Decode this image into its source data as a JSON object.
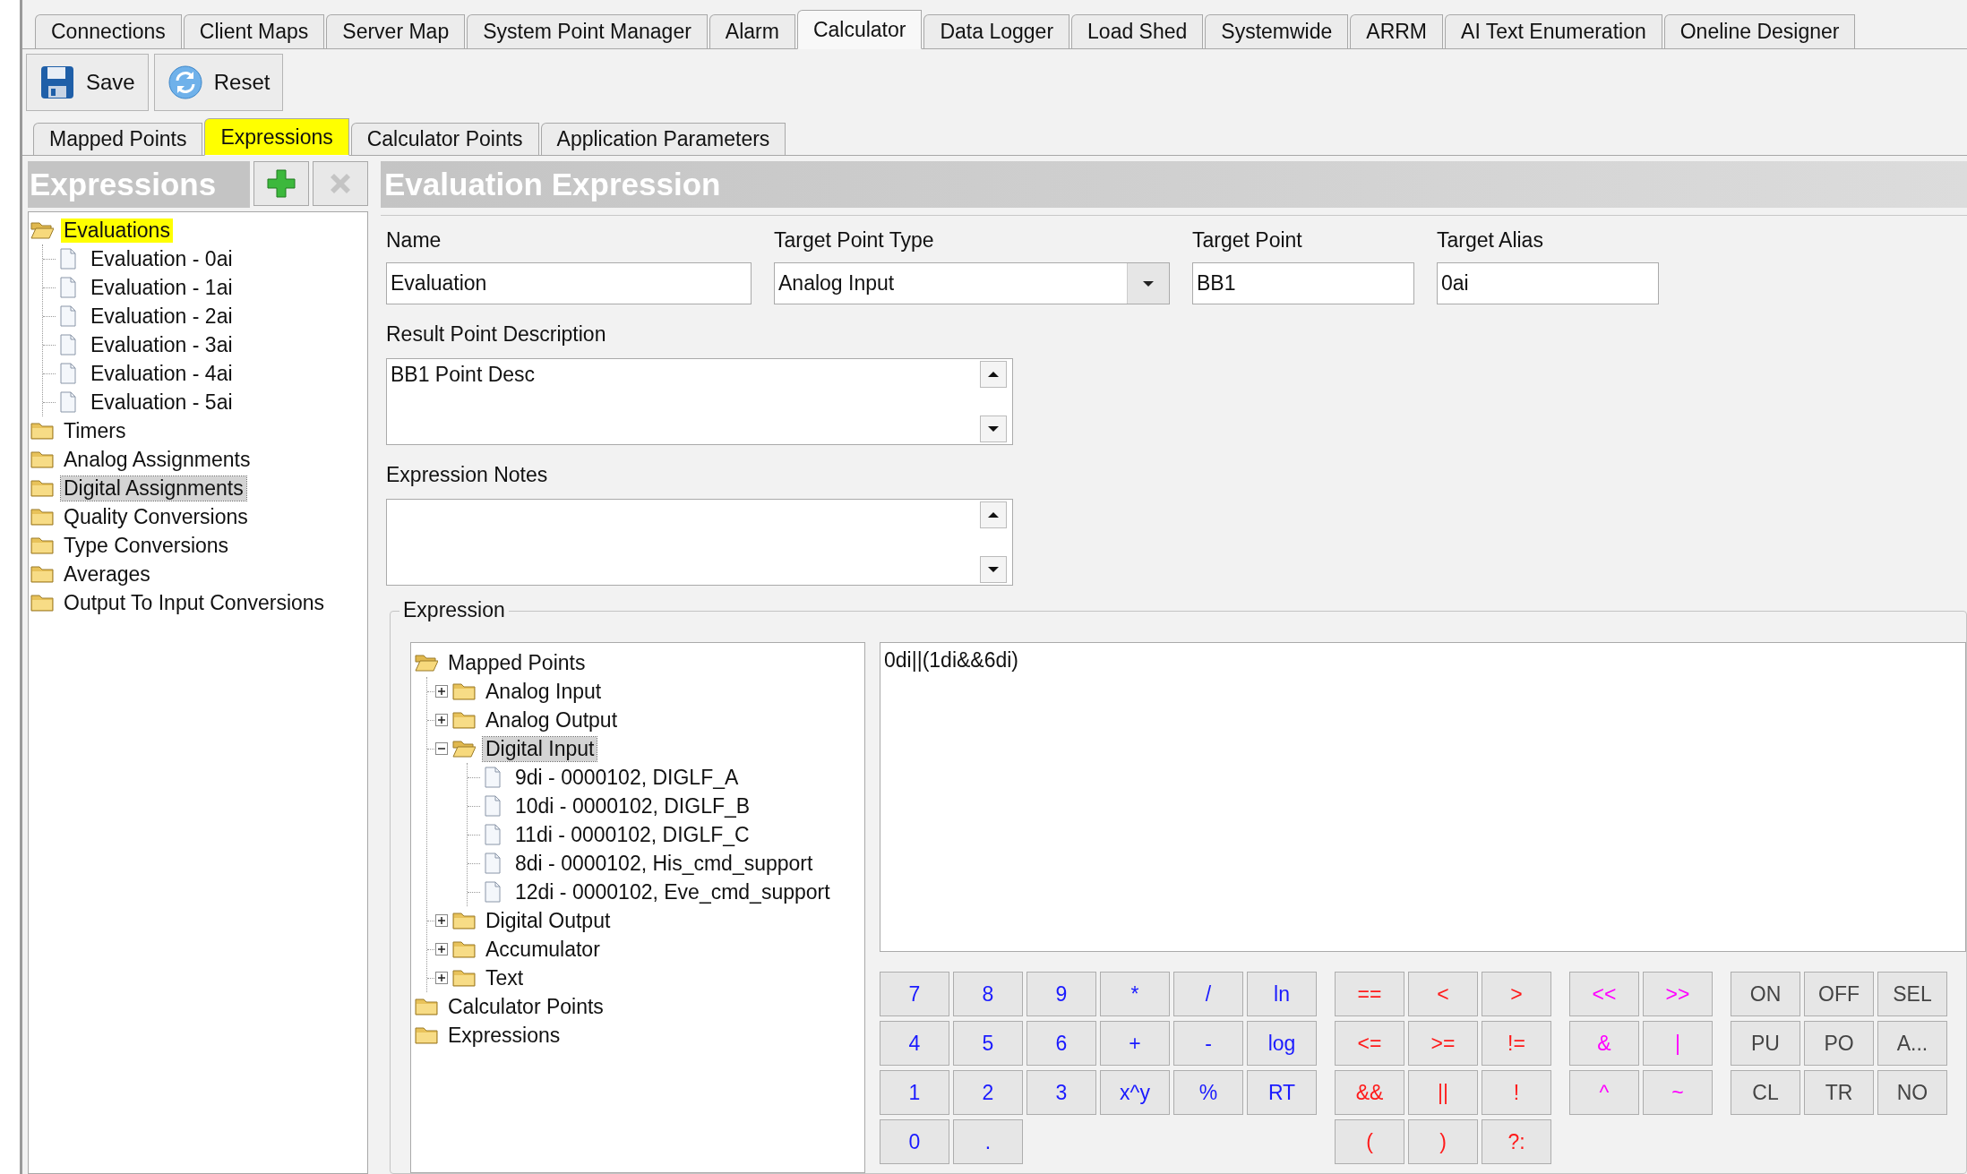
{
  "tabs": [
    {
      "label": "Connections",
      "selected": false
    },
    {
      "label": "Client Maps",
      "selected": false
    },
    {
      "label": "Server Map",
      "selected": false
    },
    {
      "label": "System Point Manager",
      "selected": false
    },
    {
      "label": "Alarm",
      "selected": false
    },
    {
      "label": "Calculator",
      "selected": true
    },
    {
      "label": "Data Logger",
      "selected": false
    },
    {
      "label": "Load Shed",
      "selected": false
    },
    {
      "label": "Systemwide",
      "selected": false
    },
    {
      "label": "ARRM",
      "selected": false
    },
    {
      "label": "AI Text Enumeration",
      "selected": false
    },
    {
      "label": "Oneline Designer",
      "selected": false
    }
  ],
  "toolbar": [
    {
      "label": "Save",
      "kind": "save"
    },
    {
      "label": "Reset",
      "kind": "reset"
    }
  ],
  "sub_tabs": [
    {
      "label": "Mapped Points",
      "selected": false,
      "highlighted": false
    },
    {
      "label": "Expressions",
      "selected": true,
      "highlighted": true
    },
    {
      "label": "Calculator Points",
      "selected": false,
      "highlighted": false
    },
    {
      "label": "Application Parameters",
      "selected": false,
      "highlighted": false
    }
  ],
  "expressions_panel": {
    "title": "Expressions",
    "actions": [
      {
        "kind": "add",
        "disabled": false
      },
      {
        "kind": "delete",
        "disabled": true
      }
    ],
    "tree": [
      {
        "label": "Evaluations",
        "kind": "folder",
        "selected": false,
        "highlighted": true,
        "children": [
          {
            "label": "Evaluation - 0ai",
            "kind": "file",
            "selected": false,
            "highlighted": false
          },
          {
            "label": "Evaluation - 1ai",
            "kind": "file",
            "selected": false,
            "highlighted": false
          },
          {
            "label": "Evaluation - 2ai",
            "kind": "file",
            "selected": false,
            "highlighted": false
          },
          {
            "label": "Evaluation - 3ai",
            "kind": "file",
            "selected": false,
            "highlighted": false
          },
          {
            "label": "Evaluation - 4ai",
            "kind": "file",
            "selected": false,
            "highlighted": false
          },
          {
            "label": "Evaluation - 5ai",
            "kind": "file",
            "selected": false,
            "highlighted": false
          }
        ]
      },
      {
        "label": "Timers",
        "kind": "folder",
        "selected": false,
        "highlighted": false
      },
      {
        "label": "Analog Assignments",
        "kind": "folder",
        "selected": false,
        "highlighted": false
      },
      {
        "label": "Digital Assignments",
        "kind": "folder",
        "selected": true,
        "highlighted": false
      },
      {
        "label": "Quality Conversions",
        "kind": "folder",
        "selected": false,
        "highlighted": false
      },
      {
        "label": "Type Conversions",
        "kind": "folder",
        "selected": false,
        "highlighted": false
      },
      {
        "label": "Averages",
        "kind": "folder",
        "selected": false,
        "highlighted": false
      },
      {
        "label": "Output To Input Conversions",
        "kind": "folder",
        "selected": false,
        "highlighted": false
      }
    ]
  },
  "editor": {
    "title": "Evaluation Expression",
    "fields": [
      {
        "label": "Name",
        "value": "Evaluation",
        "kind": "text"
      },
      {
        "label": "Target Point Type",
        "value": "Analog Input",
        "kind": "combo"
      },
      {
        "label": "Target Point",
        "value": "BB1",
        "kind": "text"
      },
      {
        "label": "Target Alias",
        "value": "0ai",
        "kind": "text"
      }
    ],
    "result_point_description": {
      "label": "Result Point Description",
      "value": "BB1 Point Desc"
    },
    "expression_notes": {
      "label": "Expression Notes"
    },
    "expression": {
      "label": "Expression",
      "tree": [
        {
          "label": "Mapped Points",
          "kind": "folder",
          "selected": false,
          "children": [
            {
              "label": "Analog Input",
              "kind": "folder",
              "selected": false,
              "expanded": false
            },
            {
              "label": "Analog Output",
              "kind": "folder",
              "selected": false,
              "expanded": false
            },
            {
              "label": "Digital Input",
              "kind": "folder",
              "selected": true,
              "expanded": true,
              "children": [
                {
                  "label": "9di - 0000102, DIGLF_A",
                  "kind": "file",
                  "selected": false
                },
                {
                  "label": "10di - 0000102, DIGLF_B",
                  "kind": "file",
                  "selected": false
                },
                {
                  "label": "11di - 0000102, DIGLF_C",
                  "kind": "file",
                  "selected": false
                },
                {
                  "label": "8di - 0000102, His_cmd_support",
                  "kind": "file",
                  "selected": false
                },
                {
                  "label": "12di - 0000102, Eve_cmd_support",
                  "kind": "file",
                  "selected": false
                }
              ]
            },
            {
              "label": "Digital Output",
              "kind": "folder",
              "selected": false,
              "expanded": false
            },
            {
              "label": "Accumulator",
              "kind": "folder",
              "selected": false,
              "expanded": false
            },
            {
              "label": "Text",
              "kind": "folder",
              "selected": false,
              "expanded": false
            }
          ]
        },
        {
          "label": "Calculator Points",
          "kind": "folder",
          "selected": false
        },
        {
          "label": "Expressions",
          "kind": "folder",
          "selected": false
        }
      ],
      "text": "0di||(1di&&6di)",
      "keypad": [
        {
          "kind": "math",
          "rows": [
            [
              "7",
              "8",
              "9",
              "*",
              "/",
              "ln"
            ],
            [
              "4",
              "5",
              "6",
              "+",
              "-",
              "log"
            ],
            [
              "1",
              "2",
              "3",
              "x^y",
              "%",
              "RT"
            ],
            [
              "0",
              "."
            ]
          ]
        },
        {
          "kind": "compare",
          "rows": [
            [
              "==",
              "<",
              ">"
            ],
            [
              "<=",
              ">=",
              "!="
            ],
            [
              "&&",
              "||",
              "!"
            ],
            [
              "(",
              ")",
              "?:"
            ]
          ]
        },
        {
          "kind": "bitwise",
          "rows": [
            [
              "<<",
              ">>"
            ],
            [
              "&",
              "|"
            ],
            [
              "^",
              "~"
            ]
          ]
        },
        {
          "kind": "state",
          "rows": [
            [
              "ON",
              "OFF",
              "SEL"
            ],
            [
              "PU",
              "PO",
              "A..."
            ],
            [
              "CL",
              "TR",
              "NO"
            ]
          ]
        }
      ]
    }
  }
}
